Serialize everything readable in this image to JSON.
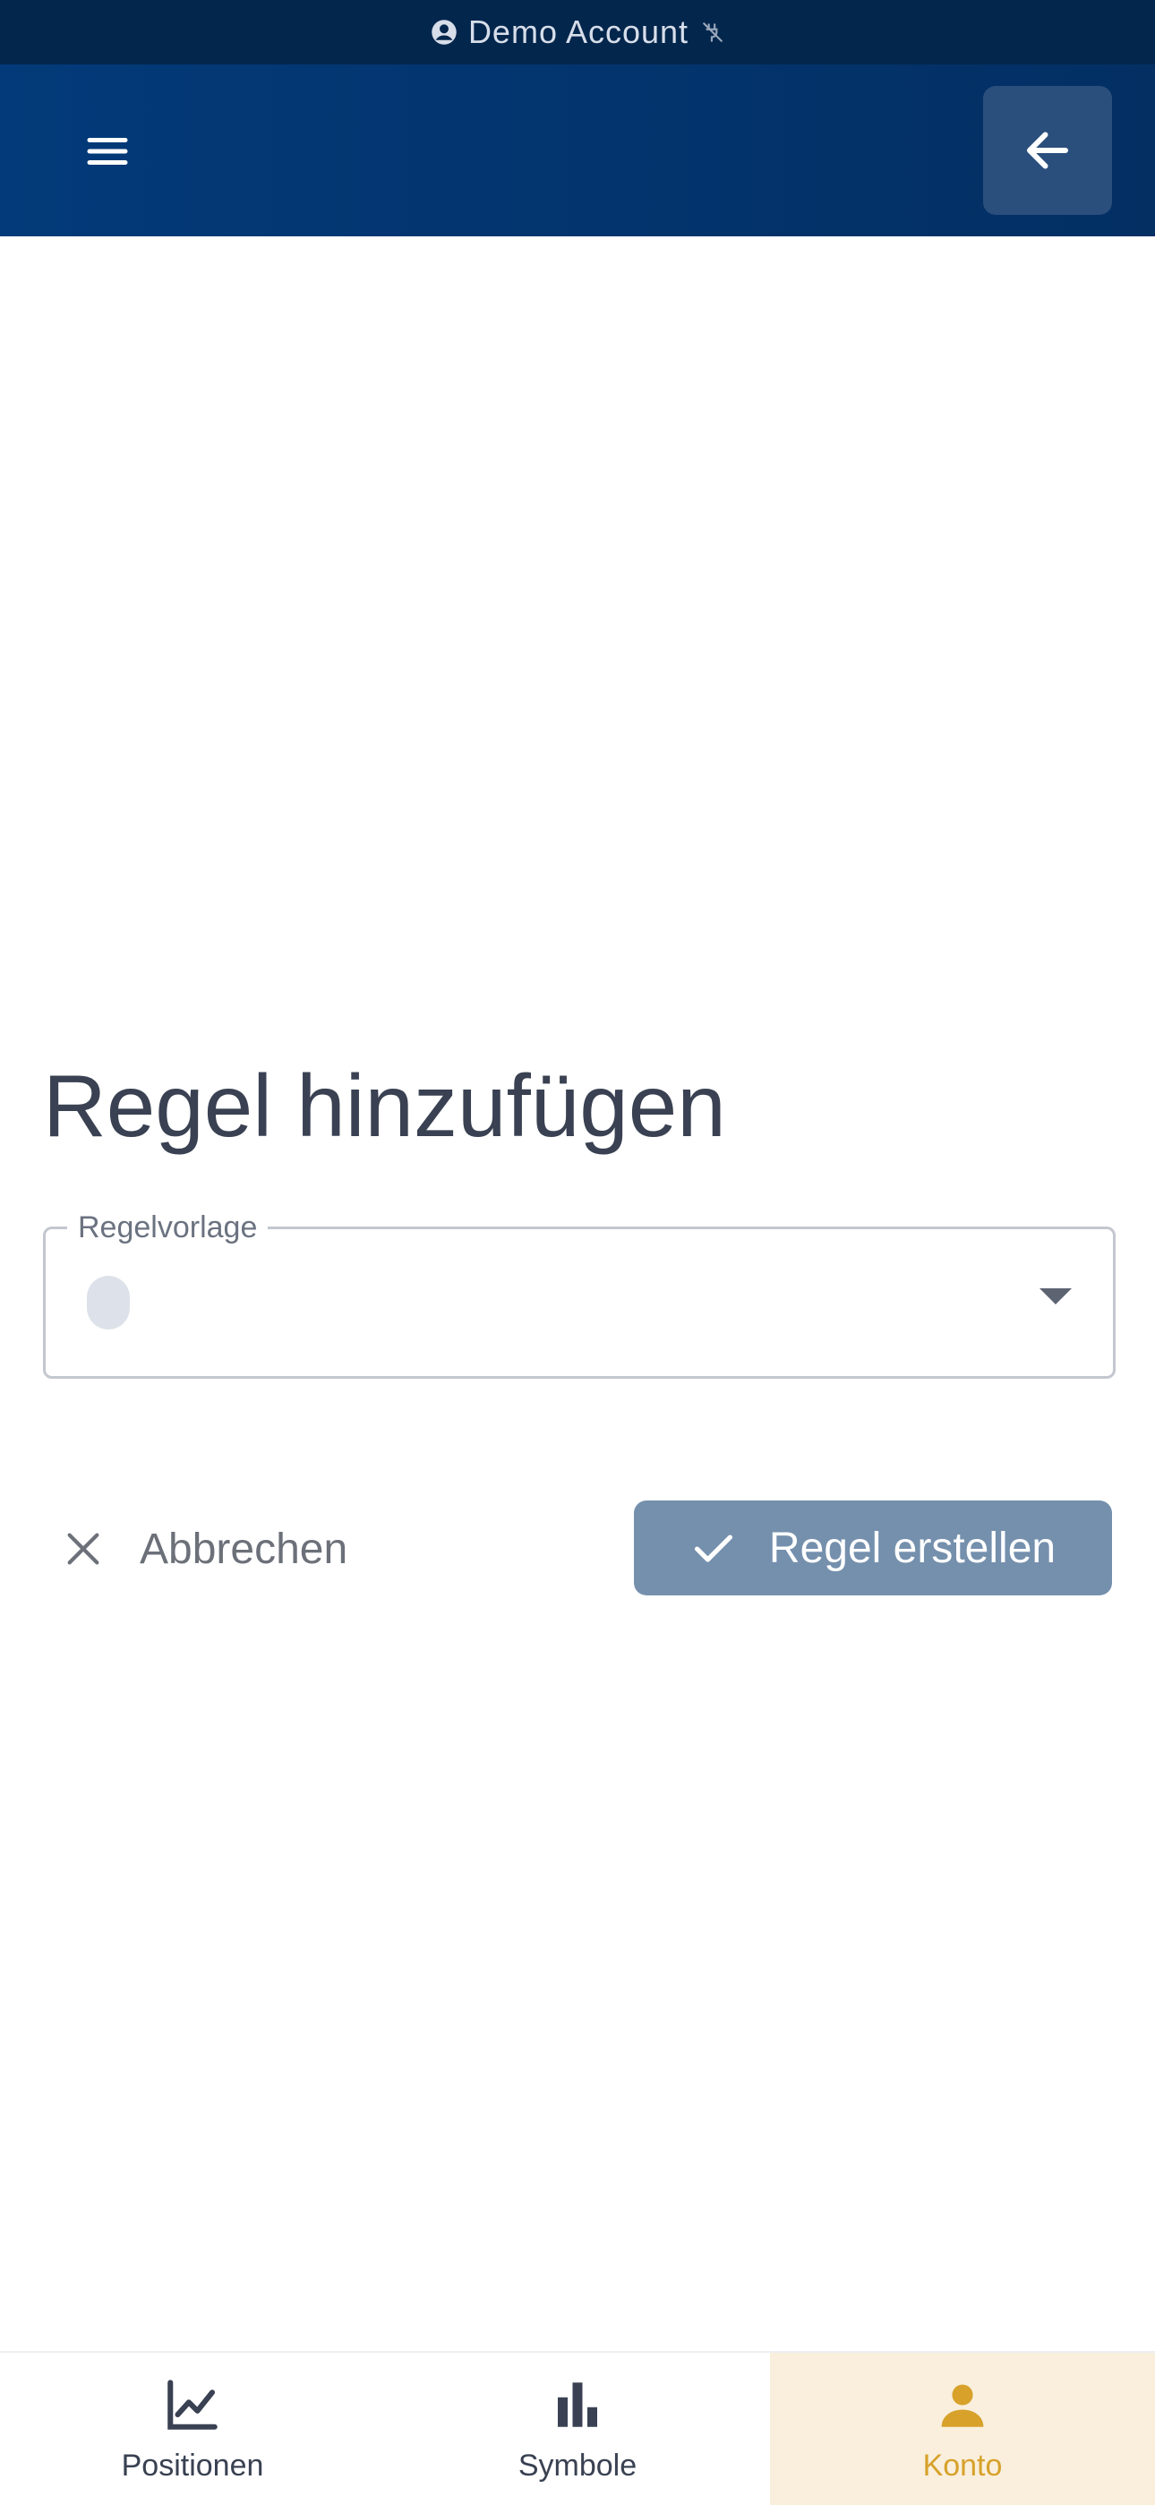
{
  "banner": {
    "text": "Demo Account",
    "icon_left": "account-circle-icon",
    "icon_right": "plug-off-icon"
  },
  "header": {
    "menu_icon": "hamburger-menu-icon",
    "back_icon": "arrow-left-icon"
  },
  "main": {
    "title": "Regel hinzufügen",
    "template_select": {
      "label": "Regelvorlage",
      "value": ""
    },
    "cancel_label": "Abbrechen",
    "create_label": "Regel erstellen"
  },
  "bottom_nav": {
    "items": [
      {
        "label": "Positionen",
        "icon": "line-chart-icon",
        "active": false
      },
      {
        "label": "Symbole",
        "icon": "bar-chart-icon",
        "active": false
      },
      {
        "label": "Konto",
        "icon": "person-icon",
        "active": true
      }
    ]
  },
  "colors": {
    "banner_bg": "#03264c",
    "header_bg": "#033a79",
    "title_text": "#394152",
    "primary_disabled": "#7590ad",
    "active_nav_bg": "#f9efdc",
    "active_nav_text": "#d7a12a"
  }
}
